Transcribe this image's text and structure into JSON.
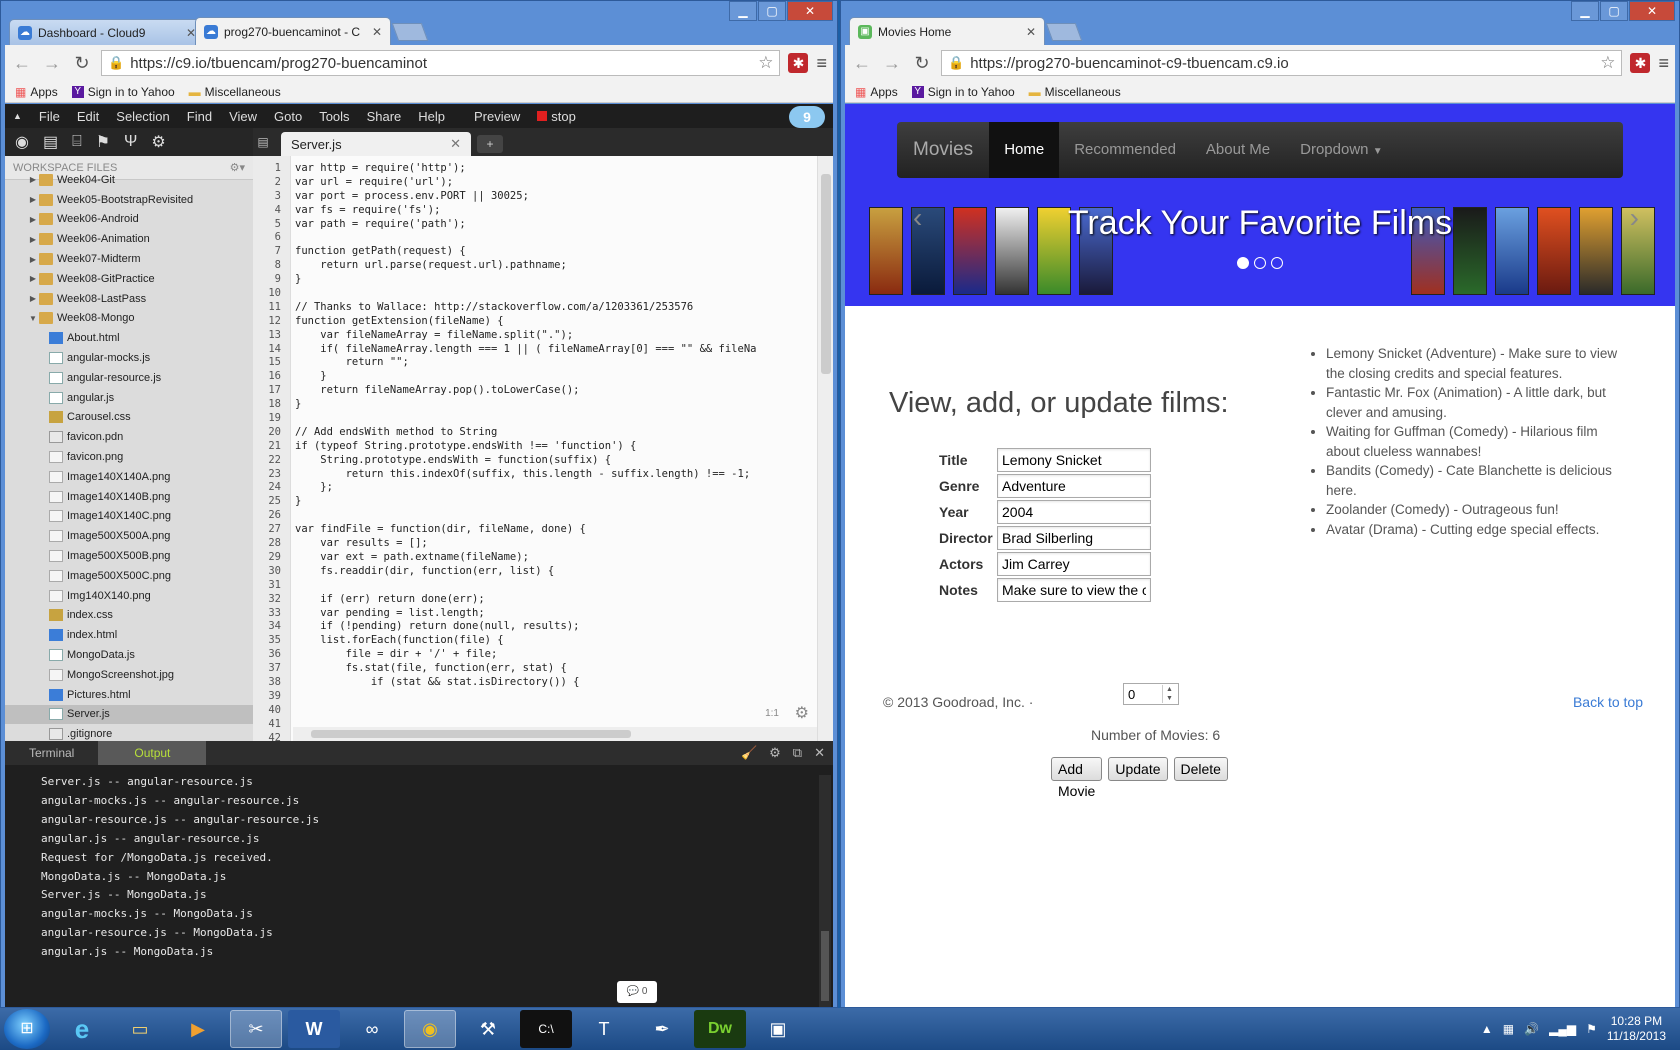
{
  "left_window": {
    "tabs": [
      {
        "label": "Dashboard - Cloud9",
        "active": false
      },
      {
        "label": "prog270-buencaminot - C",
        "active": true
      }
    ],
    "url": "https://c9.io/tbuencam/prog270-buencaminot",
    "bookmarks": [
      "Apps",
      "Sign in to Yahoo",
      "Miscellaneous"
    ],
    "menu": [
      "File",
      "Edit",
      "Selection",
      "Find",
      "View",
      "Goto",
      "Tools",
      "Share",
      "Help"
    ],
    "preview_label": "Preview",
    "stop_label": "stop",
    "badge": "9",
    "workspace_label": "WORKSPACE FILES",
    "tree": [
      {
        "name": "Week04-Git",
        "type": "folder"
      },
      {
        "name": "Week05-BootstrapRevisited",
        "type": "folder"
      },
      {
        "name": "Week06-Android",
        "type": "folder"
      },
      {
        "name": "Week06-Animation",
        "type": "folder"
      },
      {
        "name": "Week07-Midterm",
        "type": "folder"
      },
      {
        "name": "Week08-GitPractice",
        "type": "folder"
      },
      {
        "name": "Week08-LastPass",
        "type": "folder"
      },
      {
        "name": "Week08-Mongo",
        "type": "folder-open"
      },
      {
        "name": "About.html",
        "type": "html"
      },
      {
        "name": "angular-mocks.js",
        "type": "js"
      },
      {
        "name": "angular-resource.js",
        "type": "js"
      },
      {
        "name": "angular.js",
        "type": "js"
      },
      {
        "name": "Carousel.css",
        "type": "css"
      },
      {
        "name": "favicon.pdn",
        "type": "file"
      },
      {
        "name": "favicon.png",
        "type": "img"
      },
      {
        "name": "Image140X140A.png",
        "type": "img"
      },
      {
        "name": "Image140X140B.png",
        "type": "img"
      },
      {
        "name": "Image140X140C.png",
        "type": "img"
      },
      {
        "name": "Image500X500A.png",
        "type": "img"
      },
      {
        "name": "Image500X500B.png",
        "type": "img"
      },
      {
        "name": "Image500X500C.png",
        "type": "img"
      },
      {
        "name": "Img140X140.png",
        "type": "img"
      },
      {
        "name": "index.css",
        "type": "css"
      },
      {
        "name": "index.html",
        "type": "html"
      },
      {
        "name": "MongoData.js",
        "type": "js"
      },
      {
        "name": "MongoScreenshot.jpg",
        "type": "img"
      },
      {
        "name": "Pictures.html",
        "type": "html"
      },
      {
        "name": "Server.js",
        "type": "js",
        "selected": true
      },
      {
        "name": ".gitignore",
        "type": "file"
      }
    ],
    "editor_tab": "Server.js",
    "code": [
      "var http = require('http');",
      "var url = require('url');",
      "var port = process.env.PORT || 30025;",
      "var fs = require('fs');",
      "var path = require('path');",
      "",
      "function getPath(request) {",
      "    return url.parse(request.url).pathname;",
      "}",
      "",
      "// Thanks to Wallace: http://stackoverflow.com/a/1203361/253576",
      "function getExtension(fileName) {",
      "    var fileNameArray = fileName.split(\".\");",
      "    if( fileNameArray.length === 1 || ( fileNameArray[0] === \"\" && fileNa",
      "        return \"\";",
      "    }",
      "    return fileNameArray.pop().toLowerCase();",
      "}",
      "",
      "// Add endsWith method to String",
      "if (typeof String.prototype.endsWith !== 'function') {",
      "    String.prototype.endsWith = function(suffix) {",
      "        return this.indexOf(suffix, this.length - suffix.length) !== -1;",
      "    };",
      "}",
      "",
      "var findFile = function(dir, fileName, done) {",
      "    var results = [];",
      "    var ext = path.extname(fileName);",
      "    fs.readdir(dir, function(err, list) {",
      "",
      "    if (err) return done(err);",
      "    var pending = list.length;",
      "    if (!pending) return done(null, results);",
      "    list.forEach(function(file) {",
      "        file = dir + '/' + file;",
      "        fs.stat(file, function(err, stat) {",
      "            if (stat && stat.isDirectory()) {",
      "",
      "",
      "",
      ""
    ],
    "cursor_pos": "1:1",
    "console_tabs": [
      "Terminal",
      "Output"
    ],
    "console_lines": [
      "Server.js -- angular-resource.js",
      "angular-mocks.js -- angular-resource.js",
      "angular-resource.js -- angular-resource.js",
      "angular.js -- angular-resource.js",
      "Request for /MongoData.js received.",
      "MongoData.js -- MongoData.js",
      "Server.js -- MongoData.js",
      "angular-mocks.js -- MongoData.js",
      "angular-resource.js -- MongoData.js",
      "angular.js -- MongoData.js"
    ],
    "chat_count": "0"
  },
  "right_window": {
    "tab": "Movies Home",
    "url": "https://prog270-buencaminot-c9-tbuencam.c9.io",
    "bookmarks": [
      "Apps",
      "Sign in to Yahoo",
      "Miscellaneous"
    ],
    "nav": {
      "brand": "Movies",
      "links": [
        "Home",
        "Recommended",
        "About Me",
        "Dropdown"
      ]
    },
    "carousel_caption": "Track Your Favorite Films",
    "heading": "View, add, or update films:",
    "form": {
      "fields": [
        {
          "label": "Title",
          "value": "Lemony Snicket"
        },
        {
          "label": "Genre",
          "value": "Adventure"
        },
        {
          "label": "Year",
          "value": "2004"
        },
        {
          "label": "Director",
          "value": "Brad Silberling"
        },
        {
          "label": "Actors",
          "value": "Jim Carrey"
        },
        {
          "label": "Notes",
          "value": "Make sure to view the cl"
        }
      ],
      "stepper_value": "0",
      "count_label": "Number of Movies: 6",
      "buttons": [
        "Add Movie",
        "Update",
        "Delete"
      ]
    },
    "films": [
      "Lemony Snicket (Adventure) - Make sure to view the closing credits and special features.",
      "Fantastic Mr. Fox (Animation) - A little dark, but clever and amusing.",
      "Waiting for Guffman (Comedy) - Hilarious film about clueless wannabes!",
      "Bandits (Comedy) - Cate Blanchette is delicious here.",
      "Zoolander (Comedy) - Outrageous fun!",
      "Avatar (Drama) - Cutting edge special effects."
    ],
    "footer": {
      "copyright": "© 2013 Goodroad, Inc. ·",
      "back_to_top": "Back to top"
    }
  },
  "taskbar": {
    "time": "10:28 PM",
    "date": "11/18/2013"
  },
  "colors": {
    "jumbotron": "#3535f0",
    "output_tab_text": "#b8e03a",
    "ext_red": "#c0282d"
  }
}
